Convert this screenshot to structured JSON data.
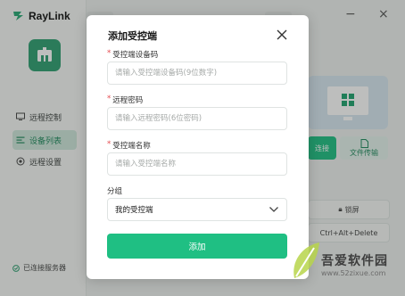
{
  "app": {
    "brand_name": "RayLink",
    "sidebar": {
      "items": [
        {
          "label": "远程控制",
          "icon": "monitor-icon"
        },
        {
          "label": "设备列表",
          "icon": "list-icon",
          "active": true
        },
        {
          "label": "远程设置",
          "icon": "settings-icon"
        }
      ],
      "status": "已连接服务器"
    },
    "right_panel": {
      "connect_label": "连接",
      "file_transfer_label": "文件传输",
      "lock_label": "锁屏",
      "ctrl_alt_del_label": "Ctrl+Alt+Delete"
    }
  },
  "modal": {
    "title": "添加受控端",
    "fields": [
      {
        "label": "受控端设备码",
        "required": true,
        "placeholder": "请输入受控端设备码(9位数字)",
        "value": ""
      },
      {
        "label": "远程密码",
        "required": true,
        "placeholder": "请输入远程密码(6位密码)",
        "value": ""
      },
      {
        "label": "受控端名称",
        "required": true,
        "placeholder": "请输入受控端名称",
        "value": ""
      }
    ],
    "group": {
      "label": "分组",
      "selected": "我的受控端"
    },
    "submit_label": "添加",
    "required_mark": "*"
  },
  "watermark": {
    "title": "吾爱软件园",
    "url": "www.52zixue.com"
  },
  "colors": {
    "accent": "#1fbf83",
    "brand": "#2e9f71",
    "required": "#e5484d"
  }
}
